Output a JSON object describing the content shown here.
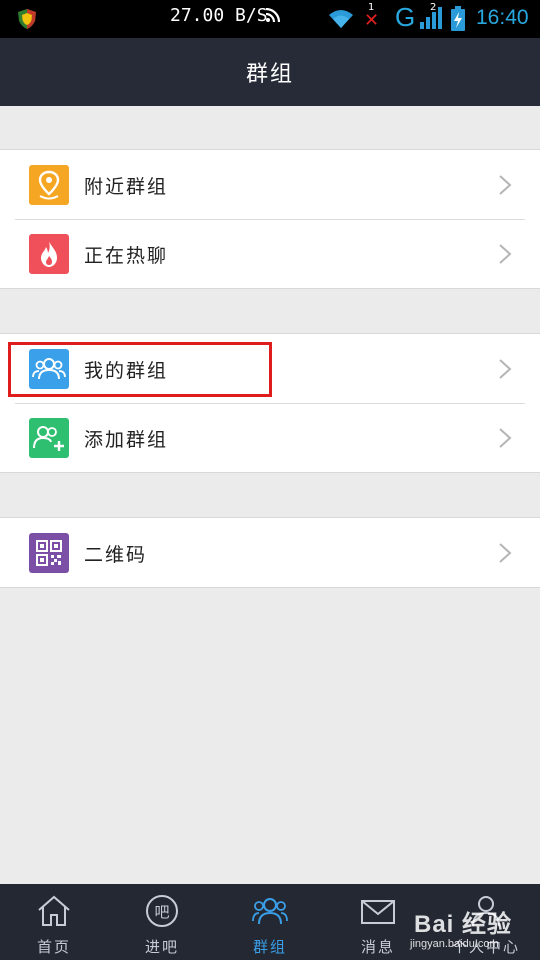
{
  "status_bar": {
    "speed": "27.00 B/S",
    "wifi_badge": "1",
    "network_type": "G",
    "signal_badge": "2",
    "time": "16:40",
    "icons": [
      "shield-icon",
      "rss-icon",
      "wifi-icon",
      "no-signal-x-icon",
      "signal-bars-icon",
      "battery-charging-icon"
    ]
  },
  "header": {
    "title": "群组"
  },
  "groups": [
    {
      "items": [
        {
          "label": "附近群组",
          "icon": "location-pin-icon",
          "color": "#f5a623"
        },
        {
          "label": "正在热聊",
          "icon": "flame-icon",
          "color": "#f0505a"
        }
      ]
    },
    {
      "items": [
        {
          "label": "我的群组",
          "icon": "people-group-icon",
          "color": "#3aa0ea",
          "highlighted": true
        },
        {
          "label": "添加群组",
          "icon": "add-people-icon",
          "color": "#2fbf71"
        }
      ]
    },
    {
      "items": [
        {
          "label": "二维码",
          "icon": "qr-code-icon",
          "color": "#7b4fa6"
        }
      ]
    }
  ],
  "tab_bar": {
    "tabs": [
      {
        "label": "首页",
        "icon": "home-icon",
        "active": false
      },
      {
        "label": "进吧",
        "icon": "ba-chat-icon",
        "active": false
      },
      {
        "label": "群组",
        "icon": "group-icon",
        "active": true
      },
      {
        "label": "消息",
        "icon": "mail-icon",
        "active": false
      },
      {
        "label": "个人中心",
        "icon": "person-icon",
        "active": false
      }
    ],
    "active_color": "#3a9fe6"
  },
  "watermark": {
    "main": "Bai 经验",
    "sub": "jingyan.baidu.com"
  }
}
